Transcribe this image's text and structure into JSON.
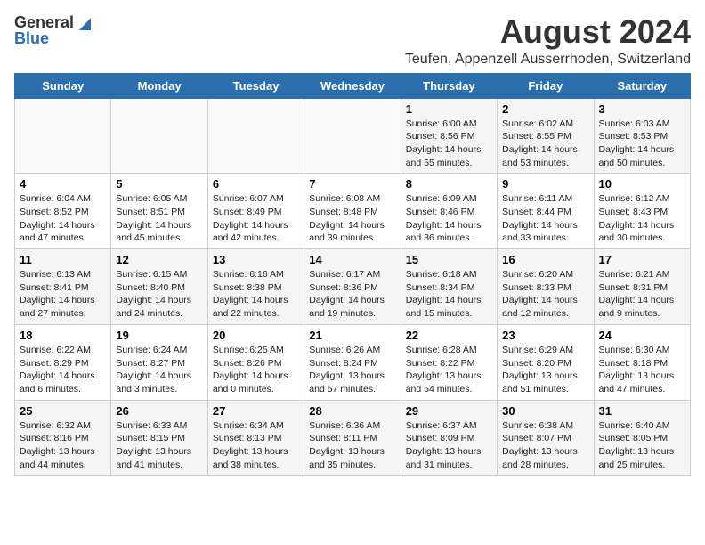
{
  "header": {
    "logo_general": "General",
    "logo_blue": "Blue",
    "main_title": "August 2024",
    "subtitle": "Teufen, Appenzell Ausserrhoden, Switzerland"
  },
  "calendar": {
    "days_of_week": [
      "Sunday",
      "Monday",
      "Tuesday",
      "Wednesday",
      "Thursday",
      "Friday",
      "Saturday"
    ],
    "weeks": [
      [
        {
          "day": "",
          "content": ""
        },
        {
          "day": "",
          "content": ""
        },
        {
          "day": "",
          "content": ""
        },
        {
          "day": "",
          "content": ""
        },
        {
          "day": "1",
          "content": "Sunrise: 6:00 AM\nSunset: 8:56 PM\nDaylight: 14 hours and 55 minutes."
        },
        {
          "day": "2",
          "content": "Sunrise: 6:02 AM\nSunset: 8:55 PM\nDaylight: 14 hours and 53 minutes."
        },
        {
          "day": "3",
          "content": "Sunrise: 6:03 AM\nSunset: 8:53 PM\nDaylight: 14 hours and 50 minutes."
        }
      ],
      [
        {
          "day": "4",
          "content": "Sunrise: 6:04 AM\nSunset: 8:52 PM\nDaylight: 14 hours and 47 minutes."
        },
        {
          "day": "5",
          "content": "Sunrise: 6:05 AM\nSunset: 8:51 PM\nDaylight: 14 hours and 45 minutes."
        },
        {
          "day": "6",
          "content": "Sunrise: 6:07 AM\nSunset: 8:49 PM\nDaylight: 14 hours and 42 minutes."
        },
        {
          "day": "7",
          "content": "Sunrise: 6:08 AM\nSunset: 8:48 PM\nDaylight: 14 hours and 39 minutes."
        },
        {
          "day": "8",
          "content": "Sunrise: 6:09 AM\nSunset: 8:46 PM\nDaylight: 14 hours and 36 minutes."
        },
        {
          "day": "9",
          "content": "Sunrise: 6:11 AM\nSunset: 8:44 PM\nDaylight: 14 hours and 33 minutes."
        },
        {
          "day": "10",
          "content": "Sunrise: 6:12 AM\nSunset: 8:43 PM\nDaylight: 14 hours and 30 minutes."
        }
      ],
      [
        {
          "day": "11",
          "content": "Sunrise: 6:13 AM\nSunset: 8:41 PM\nDaylight: 14 hours and 27 minutes."
        },
        {
          "day": "12",
          "content": "Sunrise: 6:15 AM\nSunset: 8:40 PM\nDaylight: 14 hours and 24 minutes."
        },
        {
          "day": "13",
          "content": "Sunrise: 6:16 AM\nSunset: 8:38 PM\nDaylight: 14 hours and 22 minutes."
        },
        {
          "day": "14",
          "content": "Sunrise: 6:17 AM\nSunset: 8:36 PM\nDaylight: 14 hours and 19 minutes."
        },
        {
          "day": "15",
          "content": "Sunrise: 6:18 AM\nSunset: 8:34 PM\nDaylight: 14 hours and 15 minutes."
        },
        {
          "day": "16",
          "content": "Sunrise: 6:20 AM\nSunset: 8:33 PM\nDaylight: 14 hours and 12 minutes."
        },
        {
          "day": "17",
          "content": "Sunrise: 6:21 AM\nSunset: 8:31 PM\nDaylight: 14 hours and 9 minutes."
        }
      ],
      [
        {
          "day": "18",
          "content": "Sunrise: 6:22 AM\nSunset: 8:29 PM\nDaylight: 14 hours and 6 minutes."
        },
        {
          "day": "19",
          "content": "Sunrise: 6:24 AM\nSunset: 8:27 PM\nDaylight: 14 hours and 3 minutes."
        },
        {
          "day": "20",
          "content": "Sunrise: 6:25 AM\nSunset: 8:26 PM\nDaylight: 14 hours and 0 minutes."
        },
        {
          "day": "21",
          "content": "Sunrise: 6:26 AM\nSunset: 8:24 PM\nDaylight: 13 hours and 57 minutes."
        },
        {
          "day": "22",
          "content": "Sunrise: 6:28 AM\nSunset: 8:22 PM\nDaylight: 13 hours and 54 minutes."
        },
        {
          "day": "23",
          "content": "Sunrise: 6:29 AM\nSunset: 8:20 PM\nDaylight: 13 hours and 51 minutes."
        },
        {
          "day": "24",
          "content": "Sunrise: 6:30 AM\nSunset: 8:18 PM\nDaylight: 13 hours and 47 minutes."
        }
      ],
      [
        {
          "day": "25",
          "content": "Sunrise: 6:32 AM\nSunset: 8:16 PM\nDaylight: 13 hours and 44 minutes."
        },
        {
          "day": "26",
          "content": "Sunrise: 6:33 AM\nSunset: 8:15 PM\nDaylight: 13 hours and 41 minutes."
        },
        {
          "day": "27",
          "content": "Sunrise: 6:34 AM\nSunset: 8:13 PM\nDaylight: 13 hours and 38 minutes."
        },
        {
          "day": "28",
          "content": "Sunrise: 6:36 AM\nSunset: 8:11 PM\nDaylight: 13 hours and 35 minutes."
        },
        {
          "day": "29",
          "content": "Sunrise: 6:37 AM\nSunset: 8:09 PM\nDaylight: 13 hours and 31 minutes."
        },
        {
          "day": "30",
          "content": "Sunrise: 6:38 AM\nSunset: 8:07 PM\nDaylight: 13 hours and 28 minutes."
        },
        {
          "day": "31",
          "content": "Sunrise: 6:40 AM\nSunset: 8:05 PM\nDaylight: 13 hours and 25 minutes."
        }
      ]
    ]
  }
}
